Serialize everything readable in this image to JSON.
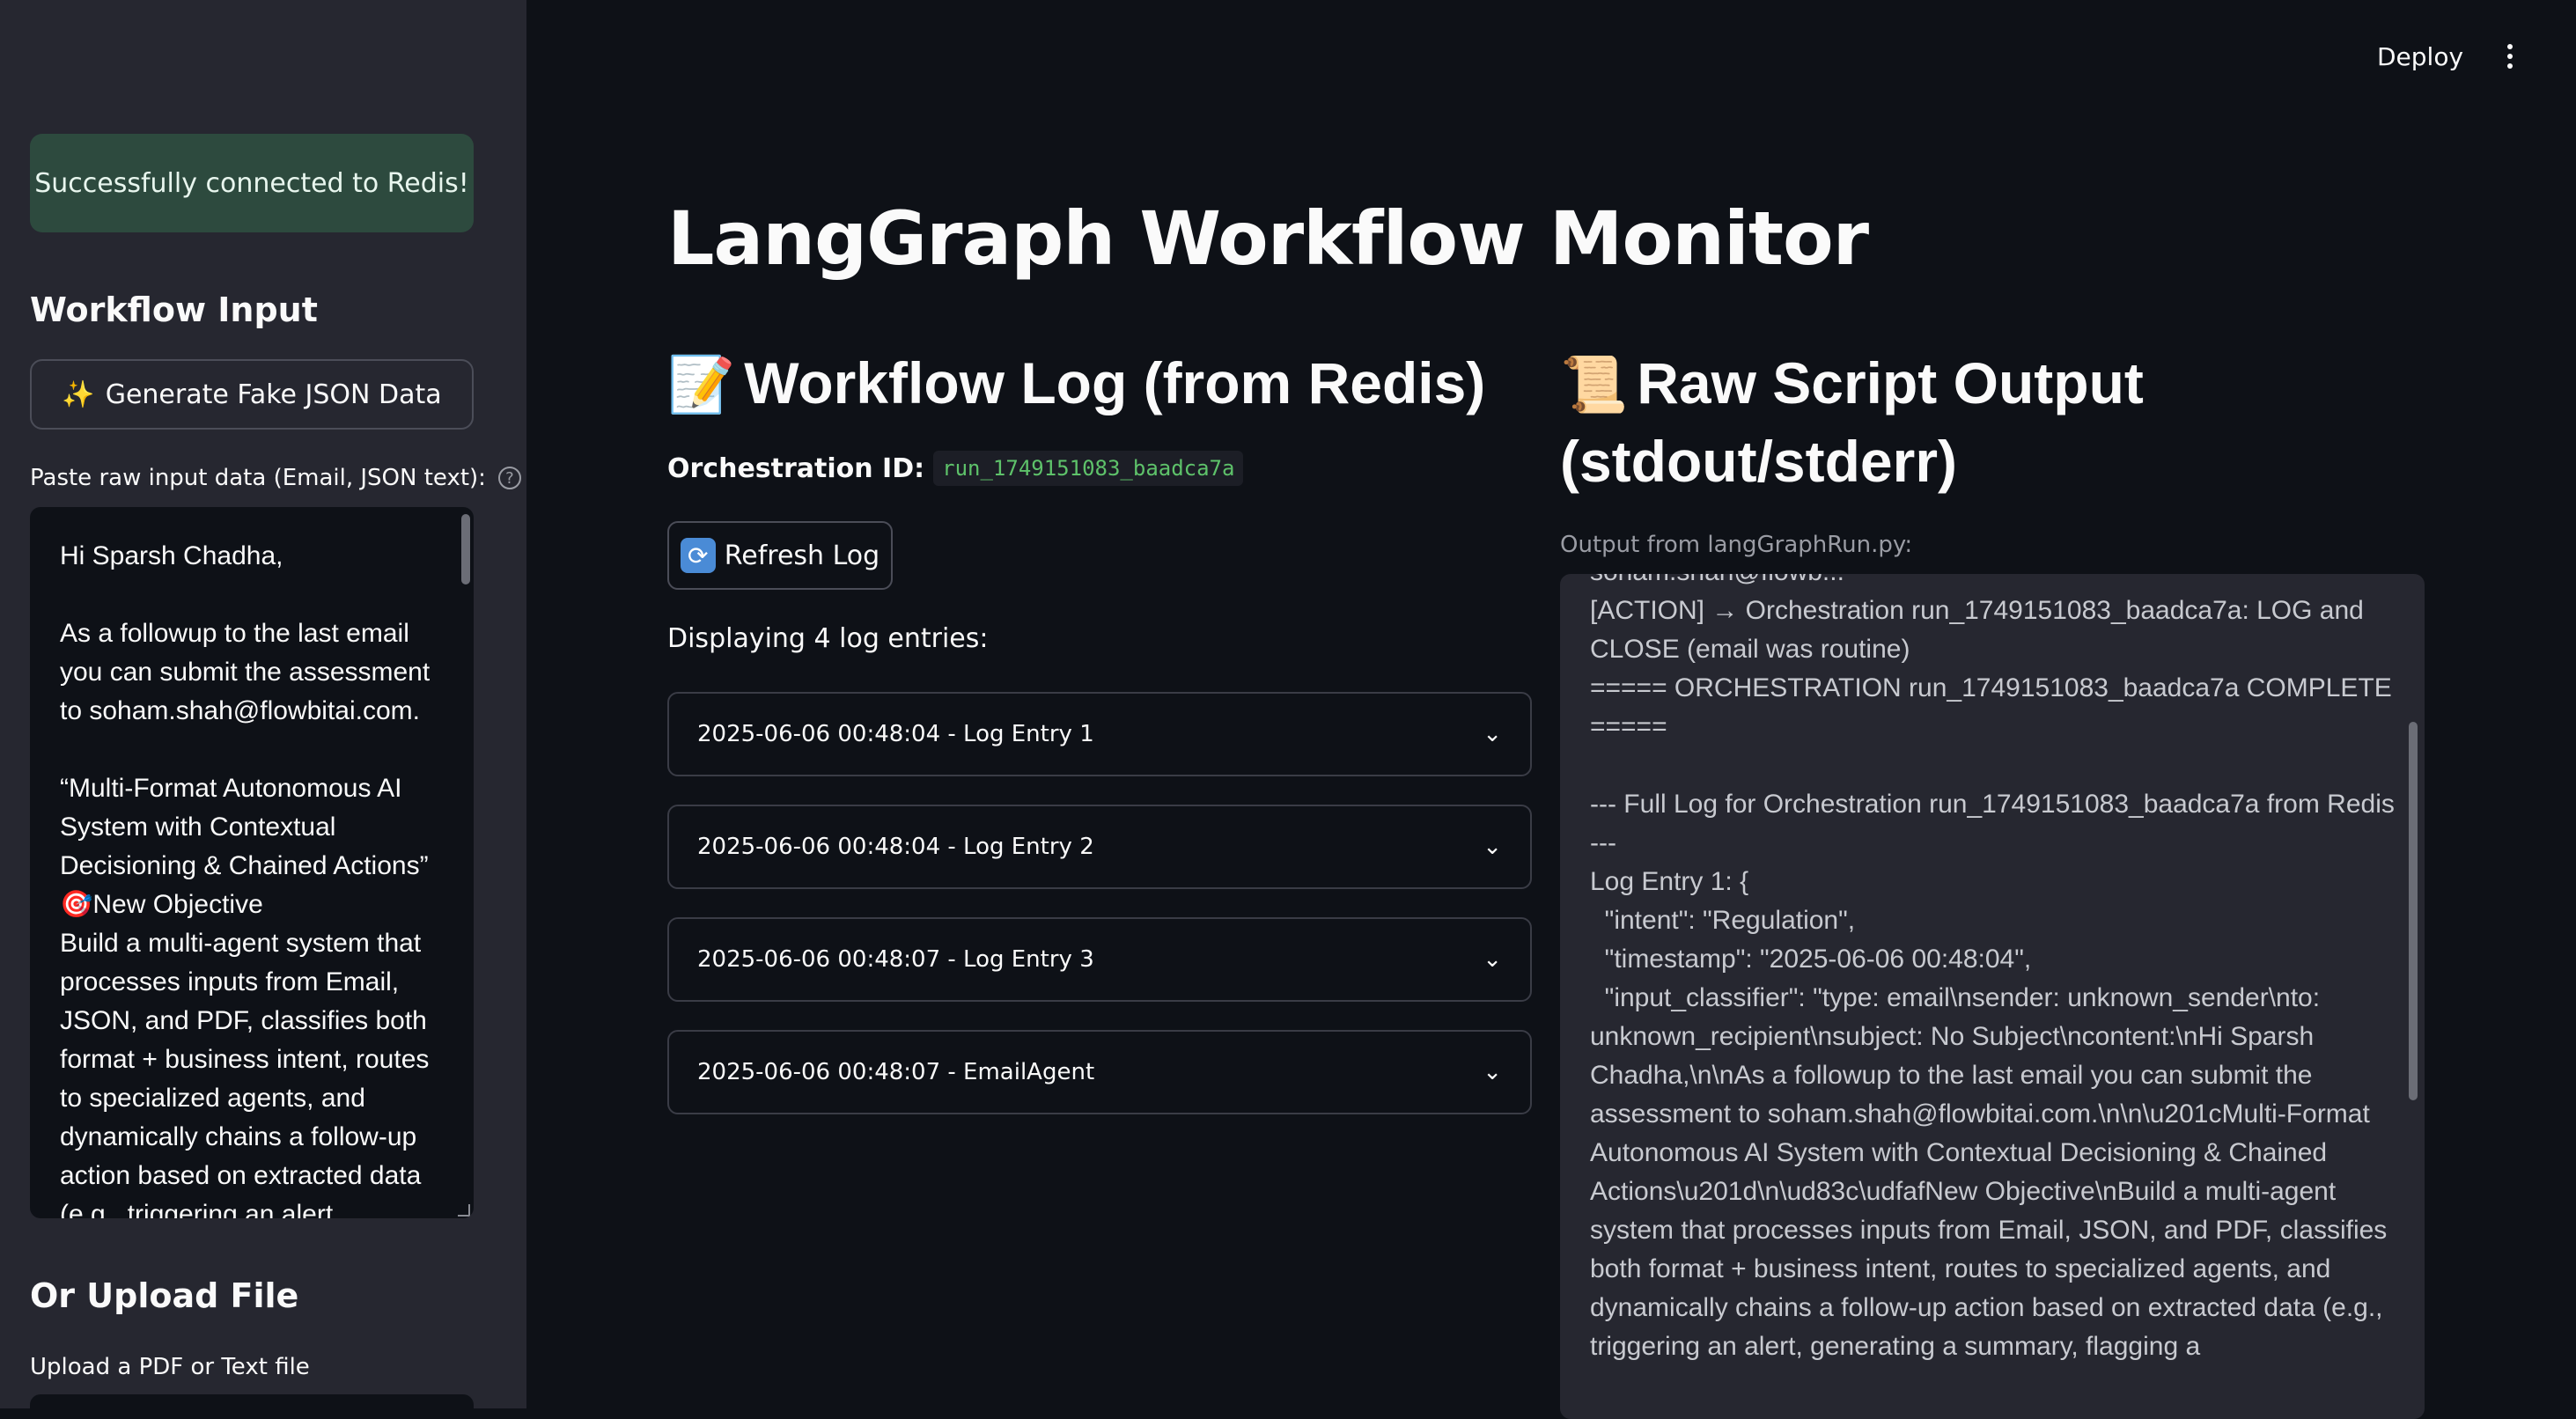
{
  "sidebar": {
    "success_message": "Successfully connected to Redis!",
    "workflow_input_heading": "Workflow Input",
    "generate_button_label": "Generate Fake JSON Data",
    "paste_label": "Paste raw input data (Email, JSON text):",
    "textarea_value": "Hi Sparsh Chadha,\n\nAs a followup to the last email you can submit the assessment to soham.shah@flowbitai.com.\n\n“Multi-Format Autonomous AI System with Contextual Decisioning & Chained Actions”\n🎯New Objective\nBuild a multi-agent system that processes inputs from Email, JSON, and PDF, classifies both format + business intent, routes to specialized agents, and dynamically chains a follow-up action based on extracted data (e.g., triggering an alert,",
    "upload_heading": "Or Upload File",
    "upload_label": "Upload a PDF or Text file"
  },
  "header": {
    "deploy_label": "Deploy"
  },
  "main": {
    "title": "LangGraph Workflow Monitor",
    "log_heading": "Workflow Log (from Redis)",
    "log_heading_icon": "📝",
    "orchestration_label": "Orchestration ID:",
    "orchestration_id": "run_1749151083_baadca7a",
    "refresh_button_label": "Refresh Log",
    "display_count_text": "Displaying 4 log entries:",
    "log_entries": [
      "2025-06-06 00:48:04 - Log Entry 1",
      "2025-06-06 00:48:04 - Log Entry 2",
      "2025-06-06 00:48:07 - Log Entry 3",
      "2025-06-06 00:48:07 - EmailAgent"
    ],
    "output_heading_line1": "Raw Script Output",
    "output_heading_line2": "(stdout/stderr)",
    "output_heading_icon": "📜",
    "output_label": "Output from langGraphRun.py:",
    "output_text": "soham.shah@flowb...\n[ACTION] → Orchestration run_1749151083_baadca7a: LOG and CLOSE (email was routine)\n===== ORCHESTRATION run_1749151083_baadca7a COMPLETE =====\n\n--- Full Log for Orchestration run_1749151083_baadca7a from Redis ---\nLog Entry 1: {\n  \"intent\": \"Regulation\",\n  \"timestamp\": \"2025-06-06 00:48:04\",\n  \"input_classifier\": \"type: email\\nsender: unknown_sender\\nto: unknown_recipient\\nsubject: No Subject\\ncontent:\\nHi Sparsh Chadha,\\n\\nAs a followup to the last email you can submit the assessment to soham.shah@flowbitai.com.\\n\\n\\u201cMulti-Format Autonomous AI System with Contextual Decisioning & Chained Actions\\u201d\\n\\ud83c\\udfafNew Objective\\nBuild a multi-agent system that processes inputs from Email, JSON, and PDF, classifies both format + business intent, routes to specialized agents, and dynamically chains a follow-up action based on extracted data (e.g., triggering an alert, generating a summary, flagging a"
  },
  "colors": {
    "background": "#0e1117",
    "sidebar": "#262730",
    "success_bg": "#2d4a3e",
    "code_green": "#5ec26a"
  }
}
